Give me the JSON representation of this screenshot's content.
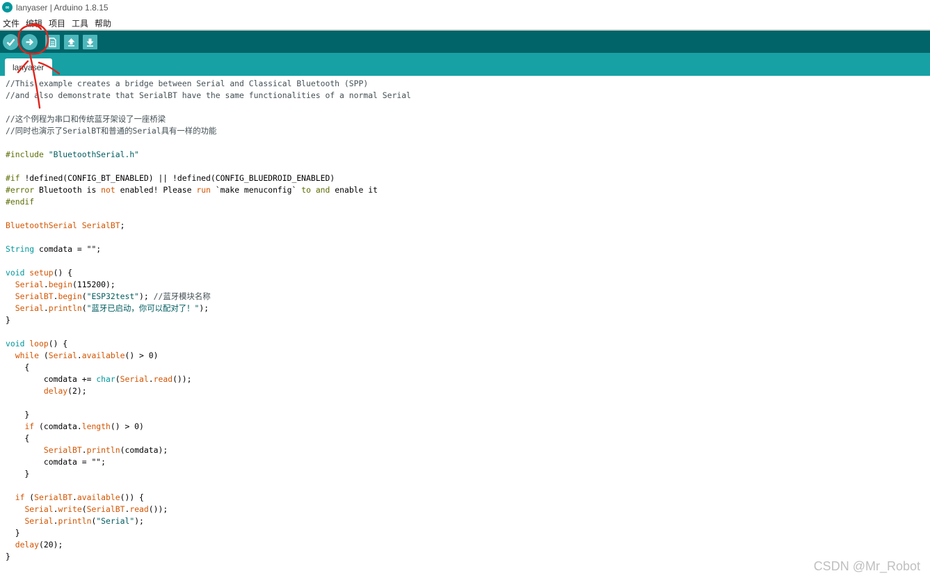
{
  "window": {
    "title": "lanyaser | Arduino 1.8.15"
  },
  "menubar": {
    "items": [
      "文件",
      "编辑",
      "项目",
      "工具",
      "帮助"
    ]
  },
  "toolbar": {
    "buttons": [
      "verify-icon",
      "upload-icon",
      "new-icon",
      "open-icon",
      "save-icon"
    ]
  },
  "tabs": [
    {
      "label": "lanyaser"
    }
  ],
  "colors": {
    "toolbar_bg": "#006468",
    "tabbar_bg": "#17a1a5",
    "button_bg": "#4db7bb",
    "annotation": "#e0241b",
    "comment": "#434f54",
    "preprocessor": "#5e6d03",
    "string": "#005c5f",
    "type": "#00979c",
    "keyword": "#d35400"
  },
  "code_lines": [
    [
      [
        "c",
        "//This example creates a bridge between Serial and Classical Bluetooth (SPP)"
      ]
    ],
    [
      [
        "c",
        "//and also demonstrate that SerialBT have the same functionalities of a normal Serial"
      ]
    ],
    [],
    [
      [
        "c",
        "//这个例程为串口和传统蓝牙架设了一座桥梁"
      ]
    ],
    [
      [
        "c",
        "//同时也演示了SerialBT和普通的Serial具有一样的功能"
      ]
    ],
    [],
    [
      [
        "p",
        "#include "
      ],
      [
        "s",
        "\"BluetoothSerial.h\""
      ]
    ],
    [],
    [
      [
        "p",
        "#if "
      ],
      [
        "n",
        "!defined(CONFIG_BT_ENABLED) || !defined(CONFIG_BLUEDROID_ENABLED)"
      ]
    ],
    [
      [
        "p",
        "#error "
      ],
      [
        "n",
        "Bluetooth "
      ],
      [
        "n",
        "is "
      ],
      [
        "k",
        "not"
      ],
      [
        "n",
        " enabled! Please "
      ],
      [
        "k",
        "run"
      ],
      [
        "n",
        " `make menuconfig` "
      ],
      [
        "p",
        "to"
      ],
      [
        "n",
        " "
      ],
      [
        "p",
        "and"
      ],
      [
        "n",
        " enable it"
      ]
    ],
    [
      [
        "p",
        "#endif"
      ]
    ],
    [],
    [
      [
        "k",
        "BluetoothSerial"
      ],
      [
        "n",
        " "
      ],
      [
        "k",
        "SerialBT"
      ],
      [
        "n",
        ";"
      ]
    ],
    [],
    [
      [
        "t",
        "String"
      ],
      [
        "n",
        " comdata = \"\";"
      ]
    ],
    [],
    [
      [
        "t",
        "void"
      ],
      [
        "n",
        " "
      ],
      [
        "k",
        "setup"
      ],
      [
        "n",
        "() {"
      ]
    ],
    [
      [
        "n",
        "  "
      ],
      [
        "k",
        "Serial"
      ],
      [
        "n",
        "."
      ],
      [
        "k",
        "begin"
      ],
      [
        "n",
        "(115200);"
      ]
    ],
    [
      [
        "n",
        "  "
      ],
      [
        "k",
        "SerialBT"
      ],
      [
        "n",
        "."
      ],
      [
        "k",
        "begin"
      ],
      [
        "n",
        "("
      ],
      [
        "s",
        "\"ESP32test\""
      ],
      [
        "n",
        "); "
      ],
      [
        "c",
        "//蓝牙模块名称"
      ]
    ],
    [
      [
        "n",
        "  "
      ],
      [
        "k",
        "Serial"
      ],
      [
        "n",
        "."
      ],
      [
        "k",
        "println"
      ],
      [
        "n",
        "("
      ],
      [
        "s",
        "\"蓝牙已启动，你可以配对了！\""
      ],
      [
        "n",
        ");"
      ]
    ],
    [
      [
        "n",
        "}"
      ]
    ],
    [],
    [
      [
        "t",
        "void"
      ],
      [
        "n",
        " "
      ],
      [
        "k",
        "loop"
      ],
      [
        "n",
        "() {"
      ]
    ],
    [
      [
        "n",
        "  "
      ],
      [
        "k",
        "while"
      ],
      [
        "n",
        " ("
      ],
      [
        "k",
        "Serial"
      ],
      [
        "n",
        "."
      ],
      [
        "k",
        "available"
      ],
      [
        "n",
        "() > 0)"
      ]
    ],
    [
      [
        "n",
        "    {"
      ]
    ],
    [
      [
        "n",
        "        comdata += "
      ],
      [
        "t",
        "char"
      ],
      [
        "n",
        "("
      ],
      [
        "k",
        "Serial"
      ],
      [
        "n",
        "."
      ],
      [
        "k",
        "read"
      ],
      [
        "n",
        "());"
      ]
    ],
    [
      [
        "n",
        "        "
      ],
      [
        "k",
        "delay"
      ],
      [
        "n",
        "(2);"
      ]
    ],
    [],
    [
      [
        "n",
        "    }"
      ]
    ],
    [
      [
        "n",
        "    "
      ],
      [
        "k",
        "if"
      ],
      [
        "n",
        " (comdata."
      ],
      [
        "k",
        "length"
      ],
      [
        "n",
        "() > 0)"
      ]
    ],
    [
      [
        "n",
        "    {"
      ]
    ],
    [
      [
        "n",
        "        "
      ],
      [
        "k",
        "SerialBT"
      ],
      [
        "n",
        "."
      ],
      [
        "k",
        "println"
      ],
      [
        "n",
        "(comdata);"
      ]
    ],
    [
      [
        "n",
        "        comdata = \"\";"
      ]
    ],
    [
      [
        "n",
        "    }"
      ]
    ],
    [],
    [
      [
        "n",
        "  "
      ],
      [
        "k",
        "if"
      ],
      [
        "n",
        " ("
      ],
      [
        "k",
        "SerialBT"
      ],
      [
        "n",
        "."
      ],
      [
        "k",
        "available"
      ],
      [
        "n",
        "()) {"
      ]
    ],
    [
      [
        "n",
        "    "
      ],
      [
        "k",
        "Serial"
      ],
      [
        "n",
        "."
      ],
      [
        "k",
        "write"
      ],
      [
        "n",
        "("
      ],
      [
        "k",
        "SerialBT"
      ],
      [
        "n",
        "."
      ],
      [
        "k",
        "read"
      ],
      [
        "n",
        "());"
      ]
    ],
    [
      [
        "n",
        "    "
      ],
      [
        "k",
        "Serial"
      ],
      [
        "n",
        "."
      ],
      [
        "k",
        "println"
      ],
      [
        "n",
        "("
      ],
      [
        "s",
        "\"Serial\""
      ],
      [
        "n",
        ");"
      ]
    ],
    [
      [
        "n",
        "  }"
      ]
    ],
    [
      [
        "n",
        "  "
      ],
      [
        "k",
        "delay"
      ],
      [
        "n",
        "(20);"
      ]
    ],
    [
      [
        "n",
        "}"
      ]
    ]
  ],
  "watermark": "CSDN @Mr_Robot"
}
